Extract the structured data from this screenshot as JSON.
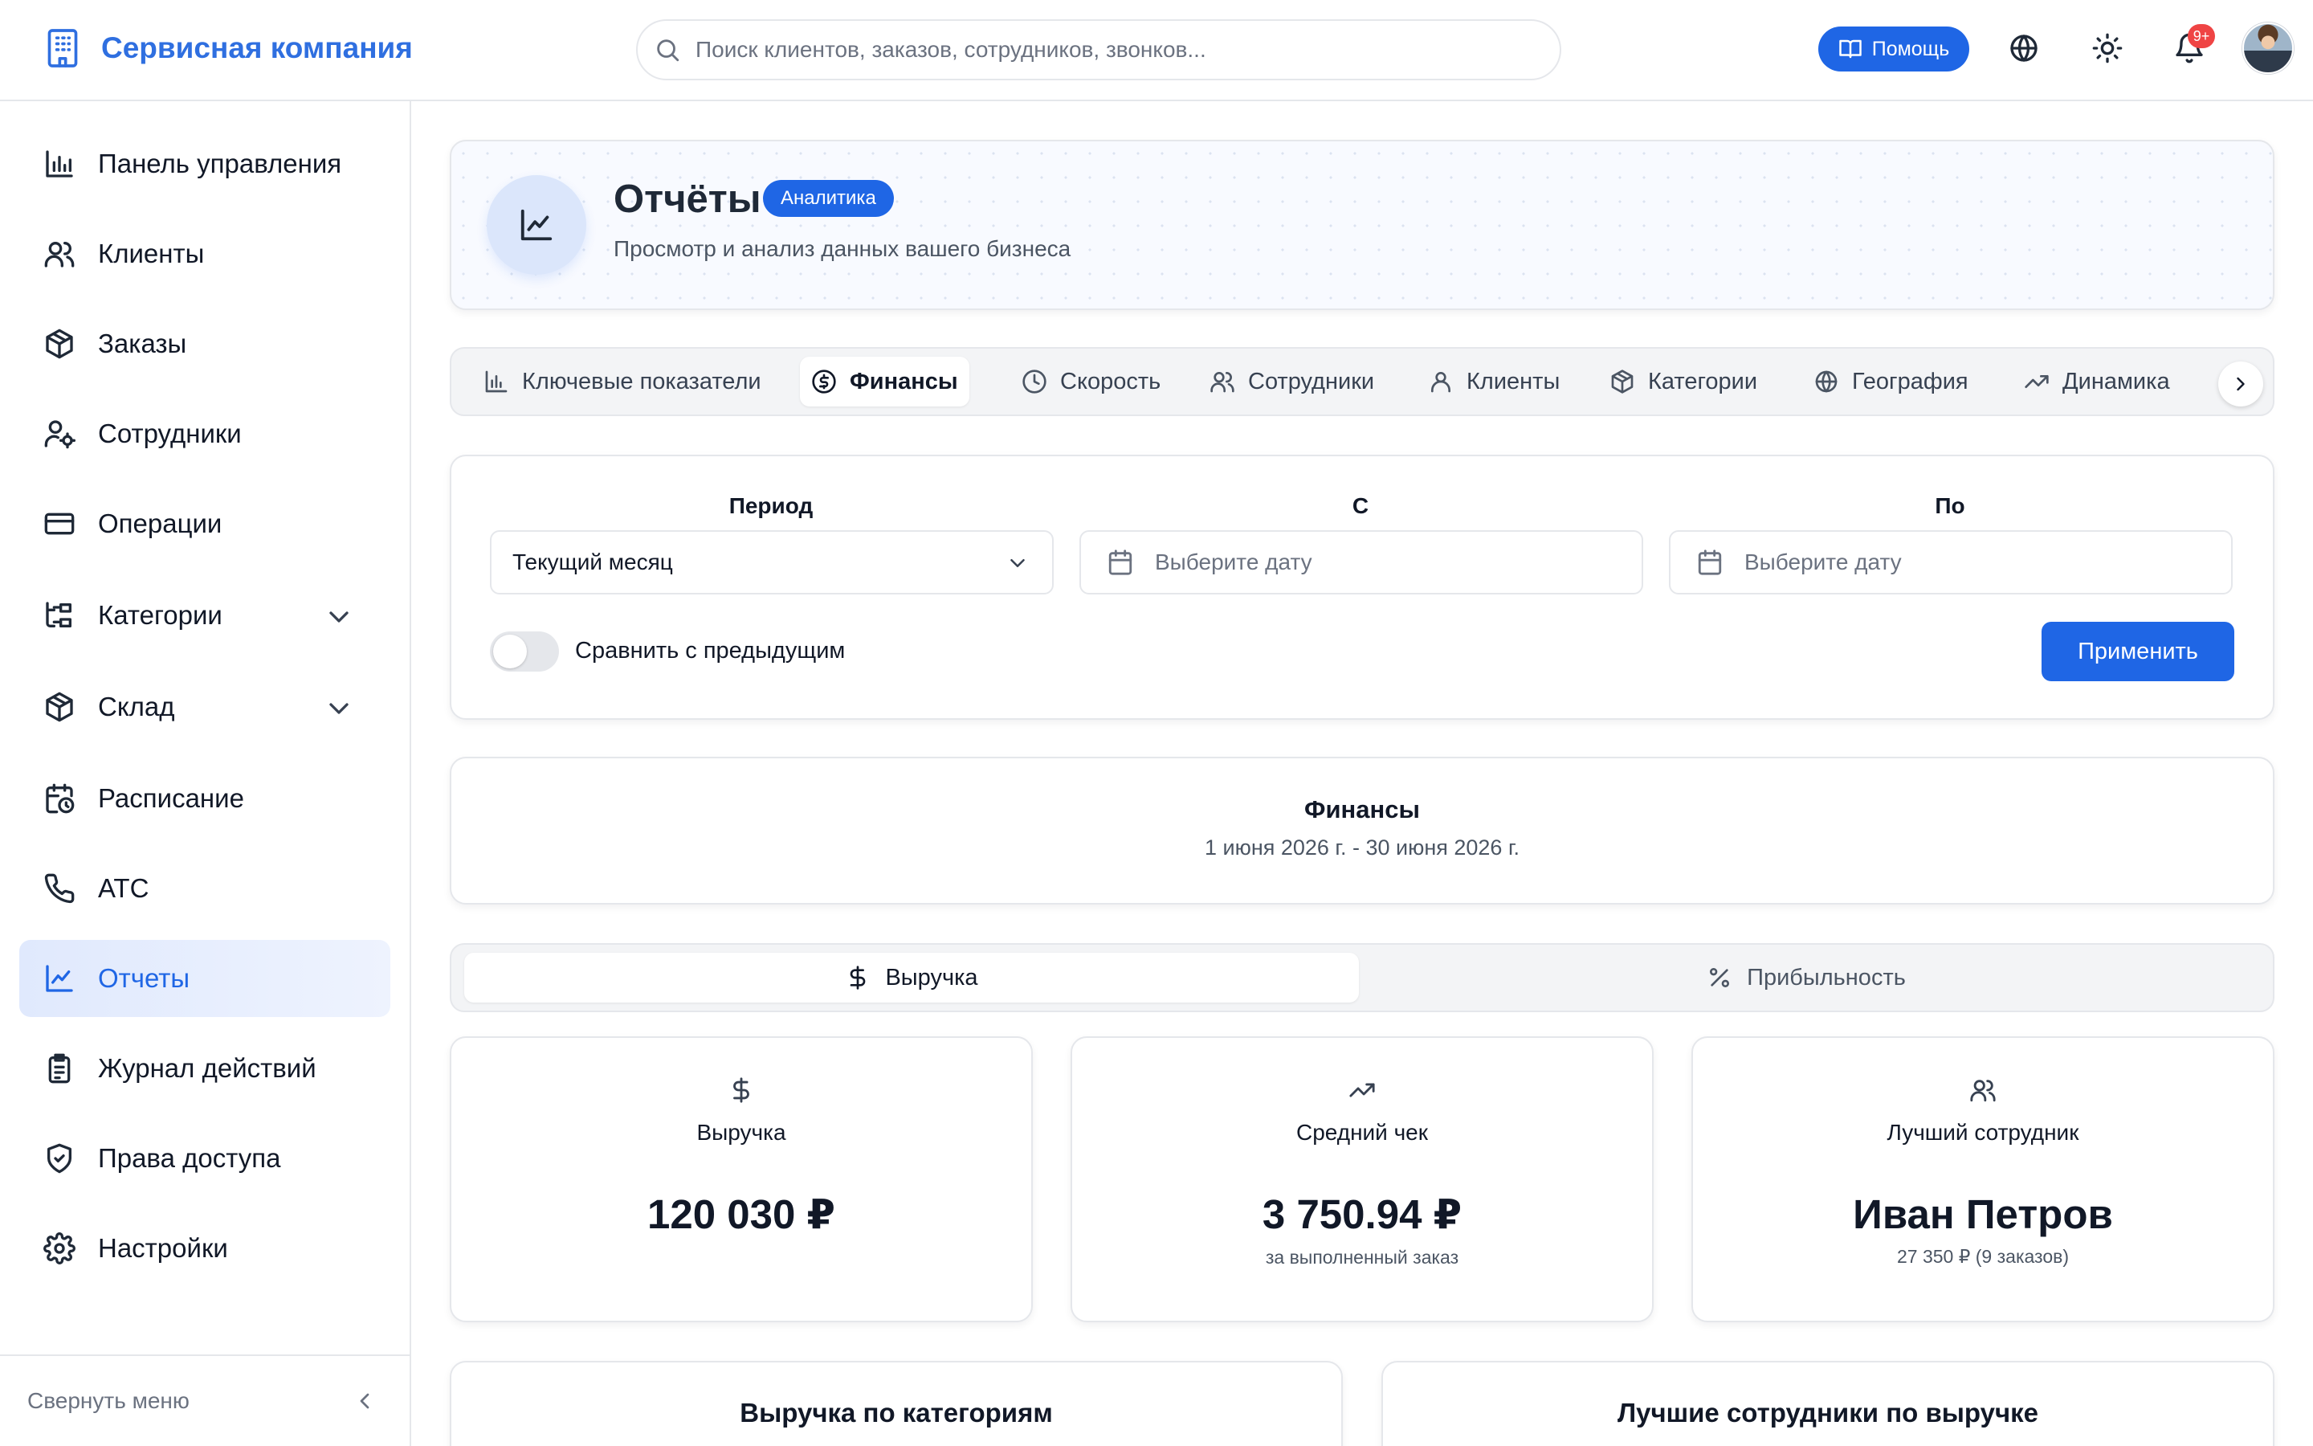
{
  "app": {
    "name": "Сервисная компания",
    "accent_color": "#1f66e5"
  },
  "header": {
    "search_placeholder": "Поиск клиентов, заказов, сотрудников, звонков...",
    "help_label": "Помощь",
    "notifications_badge": "9+"
  },
  "sidebar": {
    "items": [
      {
        "label": "Панель управления",
        "icon": "bar-chart-icon"
      },
      {
        "label": "Клиенты",
        "icon": "users-icon"
      },
      {
        "label": "Заказы",
        "icon": "package-icon"
      },
      {
        "label": "Сотрудники",
        "icon": "user-cog-icon"
      },
      {
        "label": "Операции",
        "icon": "credit-card-icon"
      },
      {
        "label": "Категории",
        "icon": "folder-tree-icon",
        "expandable": true
      },
      {
        "label": "Склад",
        "icon": "package-icon",
        "expandable": true
      },
      {
        "label": "Расписание",
        "icon": "calendar-clock-icon"
      },
      {
        "label": "АТС",
        "icon": "phone-icon"
      },
      {
        "label": "Отчеты",
        "icon": "line-chart-icon",
        "active": true
      },
      {
        "label": "Журнал действий",
        "icon": "clipboard-list-icon"
      },
      {
        "label": "Права доступа",
        "icon": "shield-check-icon"
      },
      {
        "label": "Настройки",
        "icon": "settings-icon"
      }
    ],
    "collapse_label": "Свернуть меню"
  },
  "page": {
    "title": "Отчёты",
    "badge": "Аналитика",
    "subtitle": "Просмотр и анализ данных вашего бизнеса"
  },
  "report_tabs": [
    {
      "label": "Ключевые показатели",
      "icon": "bar-chart-icon"
    },
    {
      "label": "Финансы",
      "icon": "dollar-circle-icon",
      "active": true
    },
    {
      "label": "Скорость",
      "icon": "clock-icon"
    },
    {
      "label": "Сотрудники",
      "icon": "users-icon"
    },
    {
      "label": "Клиенты",
      "icon": "user-icon"
    },
    {
      "label": "Категории",
      "icon": "package-icon"
    },
    {
      "label": "География",
      "icon": "globe-icon"
    },
    {
      "label": "Динамика",
      "icon": "trending-up-icon"
    }
  ],
  "filters": {
    "period_label": "Период",
    "period_value": "Текущий месяц",
    "from_label": "С",
    "from_placeholder": "Выберите дату",
    "to_label": "По",
    "to_placeholder": "Выберите дату",
    "compare_label": "Сравнить с предыдущим",
    "compare_enabled": false,
    "apply_label": "Применить"
  },
  "period_card": {
    "title": "Финансы",
    "range": "1 июня 2026 г. - 30 июня 2026 г."
  },
  "finance_tabs": [
    {
      "label": "Выручка",
      "icon": "dollar-icon",
      "active": true
    },
    {
      "label": "Прибыльность",
      "icon": "percent-icon"
    }
  ],
  "stats": [
    {
      "label": "Выручка",
      "value": "120 030 ₽",
      "sub": "",
      "icon": "dollar-icon"
    },
    {
      "label": "Средний чек",
      "value": "3 750.94 ₽",
      "sub": "за выполненный заказ",
      "icon": "trending-up-icon"
    },
    {
      "label": "Лучший сотрудник",
      "value": "Иван Петров",
      "sub": "27 350 ₽ (9 заказов)",
      "icon": "users-icon"
    }
  ],
  "bottom_cards": [
    {
      "title": "Выручка по категориям"
    },
    {
      "title": "Лучшие сотрудники по выручке"
    }
  ]
}
